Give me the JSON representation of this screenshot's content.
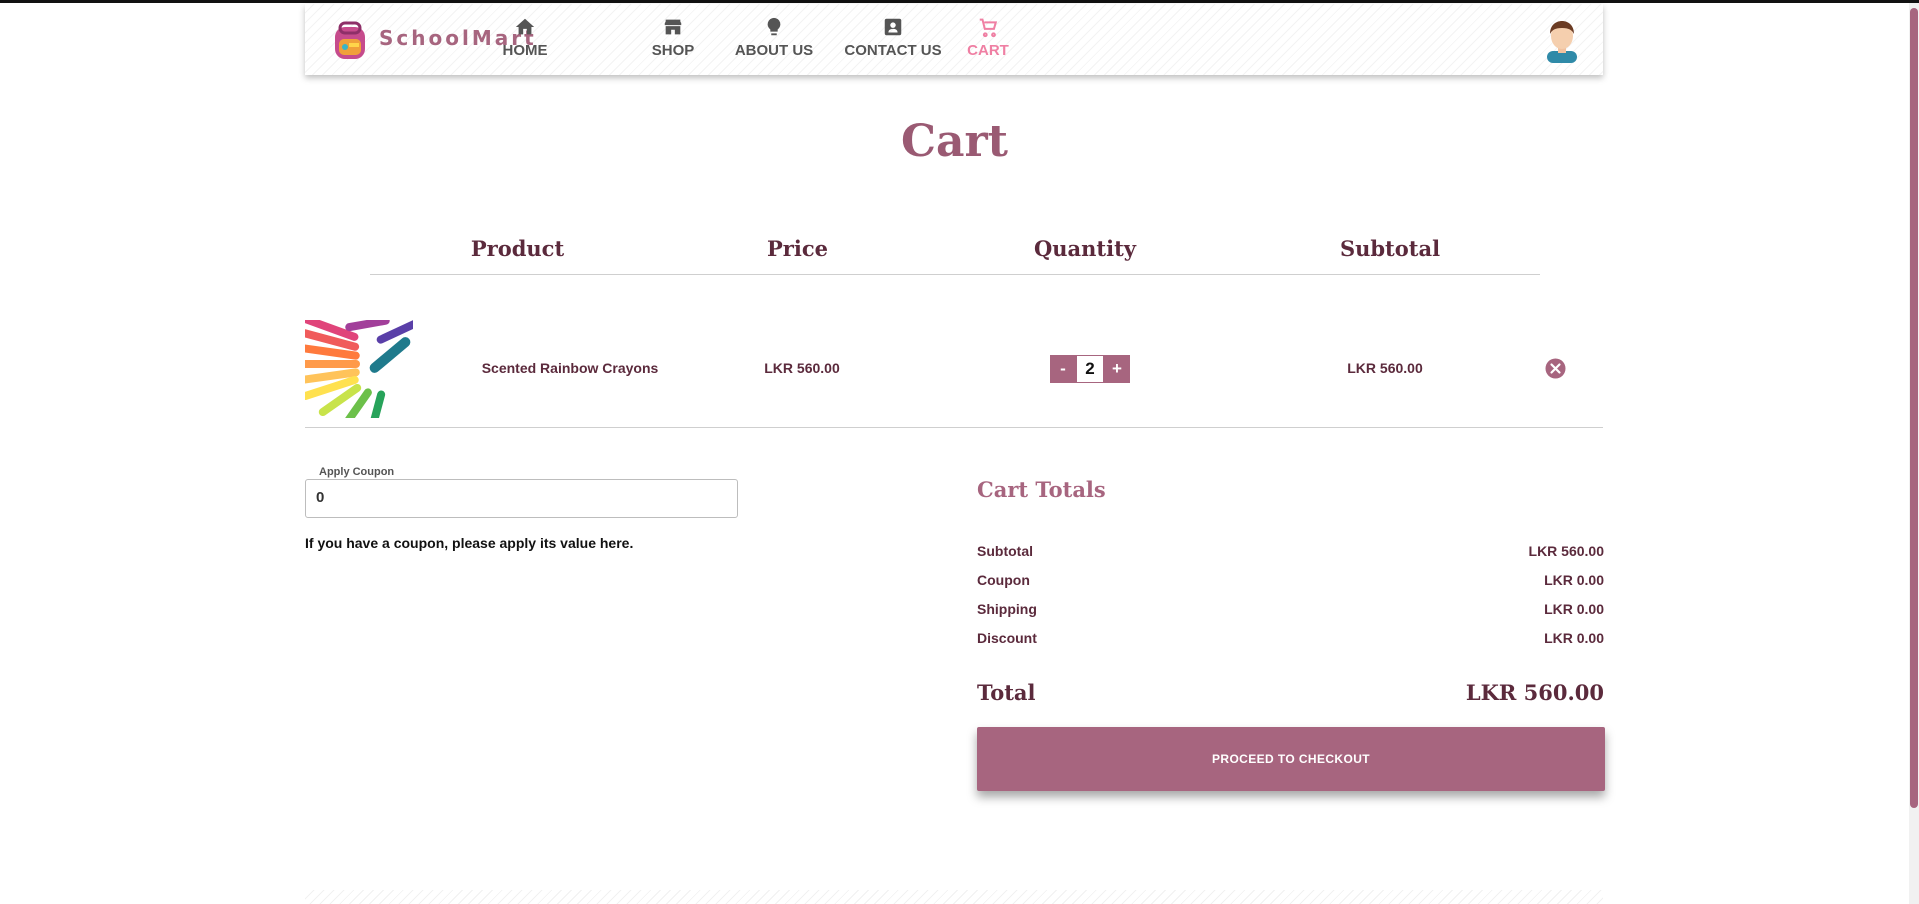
{
  "brand": {
    "name": "SchoolMart"
  },
  "nav": {
    "items": [
      {
        "label": "HOME",
        "icon": "home-icon"
      },
      {
        "label": "SHOP",
        "icon": "store-icon"
      },
      {
        "label": "ABOUT US",
        "icon": "lightbulb-icon"
      },
      {
        "label": "CONTACT US",
        "icon": "contact-card-icon"
      },
      {
        "label": "CART",
        "icon": "cart-icon",
        "active": true
      }
    ]
  },
  "page": {
    "title": "Cart"
  },
  "table": {
    "headers": [
      "Product",
      "Price",
      "Quantity",
      "Subtotal"
    ],
    "rows": [
      {
        "product": "Scented Rainbow Crayons",
        "price": "LKR 560.00",
        "quantity": "2",
        "subtotal": "LKR 560.00"
      }
    ],
    "minus_label": "-",
    "plus_label": "+"
  },
  "coupon": {
    "legend": "Apply Coupon",
    "value": "0",
    "help": "If you have a coupon, please apply its value here."
  },
  "totals": {
    "title": "Cart Totals",
    "lines": [
      {
        "label": "Subtotal",
        "value": "LKR 560.00"
      },
      {
        "label": "Coupon",
        "value": "LKR 0.00"
      },
      {
        "label": "Shipping",
        "value": "LKR 0.00"
      },
      {
        "label": "Discount",
        "value": "LKR 0.00"
      }
    ],
    "total_label": "Total",
    "total_value": "LKR 560.00",
    "checkout_label": "PROCEED TO CHECKOUT"
  },
  "colors": {
    "accent": "#a7657f",
    "active_nav": "#ef7fa3",
    "text": "#5b2a3c"
  }
}
